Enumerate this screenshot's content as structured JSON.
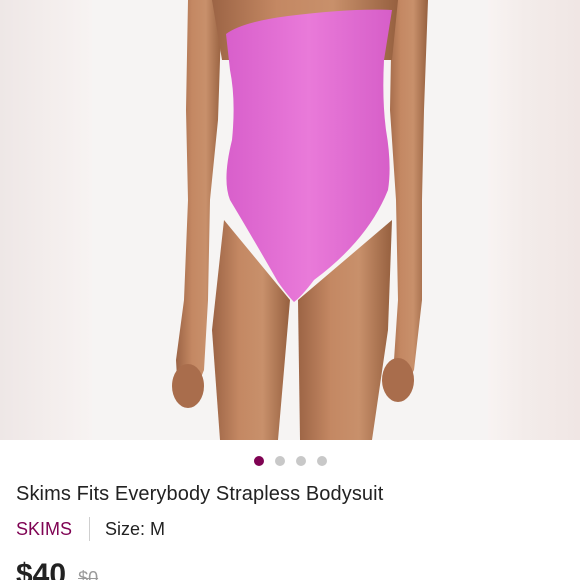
{
  "product": {
    "title": "Skims Fits Everybody Strapless Bodysuit",
    "brand": "SKIMS",
    "size_label": "Size: M",
    "price": "$40",
    "original_price": "$0"
  },
  "gallery": {
    "image_count": 4,
    "active_index": 0,
    "main_image": "model-in-pink-strapless-bodysuit"
  },
  "colors": {
    "accent": "#7f0353",
    "bodysuit": "#e56fd7",
    "dot_inactive": "#c8c8c8"
  }
}
